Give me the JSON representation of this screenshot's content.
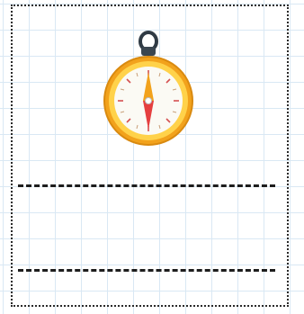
{
  "worksheet": {
    "image": {
      "icon": "compass-icon"
    },
    "writing_lines": 2,
    "colors": {
      "grid": "#d9e8f4",
      "border": "#2a2a2a",
      "dash": "#1d1d1d",
      "compass_rim": "#f2a21c",
      "compass_face": "#fbfaf4",
      "needle_red": "#e53f3f",
      "needle_orange": "#f2a21c"
    }
  }
}
